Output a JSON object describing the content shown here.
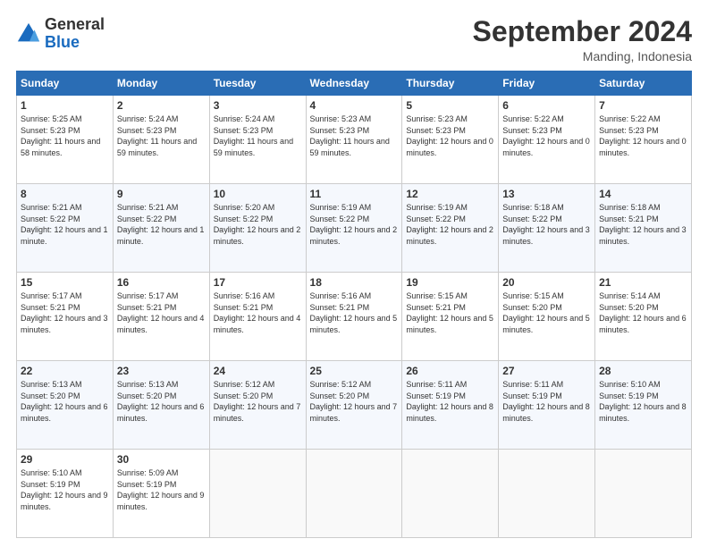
{
  "logo": {
    "general": "General",
    "blue": "Blue"
  },
  "header": {
    "month": "September 2024",
    "location": "Manding, Indonesia"
  },
  "days_of_week": [
    "Sunday",
    "Monday",
    "Tuesday",
    "Wednesday",
    "Thursday",
    "Friday",
    "Saturday"
  ],
  "weeks": [
    [
      {
        "day": "1",
        "sunrise": "5:25 AM",
        "sunset": "5:23 PM",
        "daylight": "11 hours and 58 minutes."
      },
      {
        "day": "2",
        "sunrise": "5:24 AM",
        "sunset": "5:23 PM",
        "daylight": "11 hours and 59 minutes."
      },
      {
        "day": "3",
        "sunrise": "5:24 AM",
        "sunset": "5:23 PM",
        "daylight": "11 hours and 59 minutes."
      },
      {
        "day": "4",
        "sunrise": "5:23 AM",
        "sunset": "5:23 PM",
        "daylight": "11 hours and 59 minutes."
      },
      {
        "day": "5",
        "sunrise": "5:23 AM",
        "sunset": "5:23 PM",
        "daylight": "12 hours and 0 minutes."
      },
      {
        "day": "6",
        "sunrise": "5:22 AM",
        "sunset": "5:23 PM",
        "daylight": "12 hours and 0 minutes."
      },
      {
        "day": "7",
        "sunrise": "5:22 AM",
        "sunset": "5:23 PM",
        "daylight": "12 hours and 0 minutes."
      }
    ],
    [
      {
        "day": "8",
        "sunrise": "5:21 AM",
        "sunset": "5:22 PM",
        "daylight": "12 hours and 1 minute."
      },
      {
        "day": "9",
        "sunrise": "5:21 AM",
        "sunset": "5:22 PM",
        "daylight": "12 hours and 1 minute."
      },
      {
        "day": "10",
        "sunrise": "5:20 AM",
        "sunset": "5:22 PM",
        "daylight": "12 hours and 2 minutes."
      },
      {
        "day": "11",
        "sunrise": "5:19 AM",
        "sunset": "5:22 PM",
        "daylight": "12 hours and 2 minutes."
      },
      {
        "day": "12",
        "sunrise": "5:19 AM",
        "sunset": "5:22 PM",
        "daylight": "12 hours and 2 minutes."
      },
      {
        "day": "13",
        "sunrise": "5:18 AM",
        "sunset": "5:22 PM",
        "daylight": "12 hours and 3 minutes."
      },
      {
        "day": "14",
        "sunrise": "5:18 AM",
        "sunset": "5:21 PM",
        "daylight": "12 hours and 3 minutes."
      }
    ],
    [
      {
        "day": "15",
        "sunrise": "5:17 AM",
        "sunset": "5:21 PM",
        "daylight": "12 hours and 3 minutes."
      },
      {
        "day": "16",
        "sunrise": "5:17 AM",
        "sunset": "5:21 PM",
        "daylight": "12 hours and 4 minutes."
      },
      {
        "day": "17",
        "sunrise": "5:16 AM",
        "sunset": "5:21 PM",
        "daylight": "12 hours and 4 minutes."
      },
      {
        "day": "18",
        "sunrise": "5:16 AM",
        "sunset": "5:21 PM",
        "daylight": "12 hours and 5 minutes."
      },
      {
        "day": "19",
        "sunrise": "5:15 AM",
        "sunset": "5:21 PM",
        "daylight": "12 hours and 5 minutes."
      },
      {
        "day": "20",
        "sunrise": "5:15 AM",
        "sunset": "5:20 PM",
        "daylight": "12 hours and 5 minutes."
      },
      {
        "day": "21",
        "sunrise": "5:14 AM",
        "sunset": "5:20 PM",
        "daylight": "12 hours and 6 minutes."
      }
    ],
    [
      {
        "day": "22",
        "sunrise": "5:13 AM",
        "sunset": "5:20 PM",
        "daylight": "12 hours and 6 minutes."
      },
      {
        "day": "23",
        "sunrise": "5:13 AM",
        "sunset": "5:20 PM",
        "daylight": "12 hours and 6 minutes."
      },
      {
        "day": "24",
        "sunrise": "5:12 AM",
        "sunset": "5:20 PM",
        "daylight": "12 hours and 7 minutes."
      },
      {
        "day": "25",
        "sunrise": "5:12 AM",
        "sunset": "5:20 PM",
        "daylight": "12 hours and 7 minutes."
      },
      {
        "day": "26",
        "sunrise": "5:11 AM",
        "sunset": "5:19 PM",
        "daylight": "12 hours and 8 minutes."
      },
      {
        "day": "27",
        "sunrise": "5:11 AM",
        "sunset": "5:19 PM",
        "daylight": "12 hours and 8 minutes."
      },
      {
        "day": "28",
        "sunrise": "5:10 AM",
        "sunset": "5:19 PM",
        "daylight": "12 hours and 8 minutes."
      }
    ],
    [
      {
        "day": "29",
        "sunrise": "5:10 AM",
        "sunset": "5:19 PM",
        "daylight": "12 hours and 9 minutes."
      },
      {
        "day": "30",
        "sunrise": "5:09 AM",
        "sunset": "5:19 PM",
        "daylight": "12 hours and 9 minutes."
      },
      null,
      null,
      null,
      null,
      null
    ]
  ]
}
